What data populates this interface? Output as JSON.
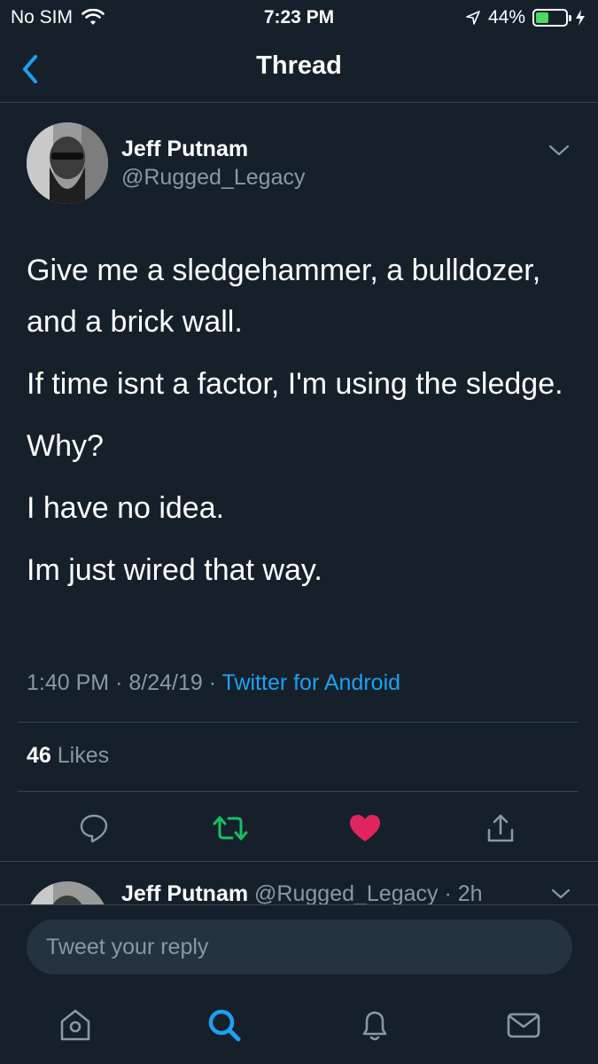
{
  "status_bar": {
    "carrier": "No SIM",
    "time": "7:23 PM",
    "battery_percent": "44%",
    "battery_level": 0.44
  },
  "header": {
    "title": "Thread"
  },
  "tweet": {
    "author_name": "Jeff Putnam",
    "author_handle": "@Rugged_Legacy",
    "paragraphs": [
      "Give me a sledgehammer, a bulldozer, and a brick wall.",
      "If time isnt a factor, I'm using the sledge.",
      "Why?",
      "I have no idea.",
      "Im just wired that way."
    ],
    "time": "1:40 PM",
    "date": "8/24/19",
    "source": "Twitter for Android",
    "likes_count": "46",
    "likes_label": "Likes"
  },
  "reply_preview": {
    "author_name": "Jeff Putnam",
    "author_handle": "@Rugged_Legacy",
    "age": "2h"
  },
  "composer": {
    "placeholder": "Tweet your reply"
  },
  "icons": {
    "back": "chevron-left-icon",
    "caret": "chevron-down-icon",
    "reply": "speech-bubble-icon",
    "retweet": "retweet-icon",
    "like": "heart-icon",
    "share": "share-icon",
    "home": "home-icon",
    "search": "search-icon",
    "notifications": "bell-icon",
    "messages": "mail-icon"
  },
  "colors": {
    "background": "#15202b",
    "accent": "#1da1f2",
    "retweet_active": "#17bf63",
    "like_active": "#e0245e",
    "secondary_text": "#8899a6"
  }
}
